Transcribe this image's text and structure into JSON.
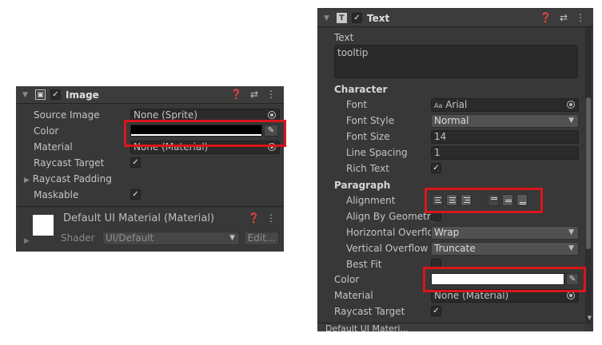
{
  "image_component": {
    "title": "Image",
    "icons": [
      "help-icon",
      "presets-icon",
      "more-icon"
    ],
    "rows": {
      "source_image_label": "Source Image",
      "source_image_value": "None (Sprite)",
      "color_label": "Color",
      "material_label": "Material",
      "material_value": "None (Material)",
      "raycast_target_label": "Raycast Target",
      "raycast_padding_label": "Raycast Padding",
      "maskable_label": "Maskable"
    },
    "color_value": "#000000",
    "material_section": {
      "title": "Default UI Material (Material)",
      "shader_label": "Shader",
      "shader_value": "UI/Default",
      "edit_label": "Edit..."
    }
  },
  "text_component": {
    "title": "Text",
    "text_label": "Text",
    "text_value": "tooltip",
    "character_header": "Character",
    "font_label": "Font",
    "font_prefix": "Aa",
    "font_value": "Arial",
    "font_style_label": "Font Style",
    "font_style_value": "Normal",
    "font_size_label": "Font Size",
    "font_size_value": "14",
    "line_spacing_label": "Line Spacing",
    "line_spacing_value": "1",
    "rich_text_label": "Rich Text",
    "paragraph_header": "Paragraph",
    "alignment_label": "Alignment",
    "align_by_geometry_label": "Align By Geometry",
    "horizontal_overflow_label": "Horizontal Overflo",
    "horizontal_overflow_value": "Wrap",
    "vertical_overflow_label": "Vertical Overflow",
    "vertical_overflow_value": "Truncate",
    "best_fit_label": "Best Fit",
    "color_label": "Color",
    "color_value": "#ffffff",
    "material_label": "Material",
    "material_value": "None (Material)",
    "raycast_target_label": "Raycast Target",
    "cut_off_label": "Default UI Materi..."
  },
  "colors": {
    "highlight": "#d9161c",
    "panel_bg": "#383838"
  }
}
